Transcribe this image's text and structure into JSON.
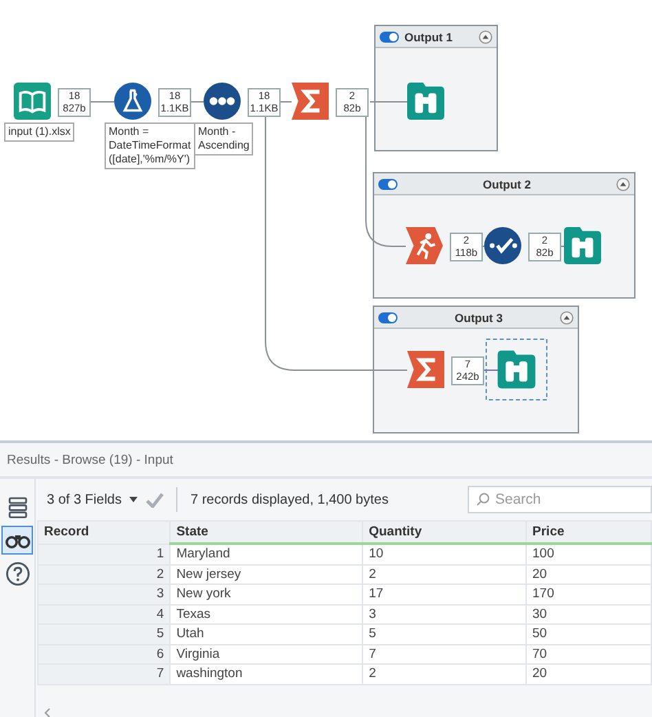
{
  "workflow": {
    "tools": [
      {
        "kind": "input",
        "label": "input (1).xlsx",
        "selected": false,
        "output": {
          "records": "18",
          "size": "827b"
        }
      },
      {
        "kind": "formula",
        "label": "Month =\nDateTimeFormat\n([date],'%m/%Y')",
        "selected": false,
        "output": {
          "records": "18",
          "size": "1.1KB"
        }
      },
      {
        "kind": "sort",
        "label": "Month -\nAscending",
        "selected": false,
        "output": {
          "records": "18",
          "size": "1.1KB"
        }
      },
      {
        "kind": "summarize",
        "selected": false,
        "output": {
          "records": "2",
          "size": "82b"
        }
      }
    ],
    "containers": [
      {
        "title": "Output 1",
        "enabled": true,
        "tools": [
          {
            "kind": "browse",
            "selected": false
          }
        ]
      },
      {
        "title": "Output 2",
        "enabled": true,
        "tools": [
          {
            "kind": "filter",
            "selected": false,
            "output": {
              "records": "2",
              "size": "118b"
            }
          },
          {
            "kind": "select",
            "selected": false,
            "output": {
              "records": "2",
              "size": "82b"
            }
          },
          {
            "kind": "browse",
            "selected": false
          }
        ]
      },
      {
        "title": "Output 3",
        "enabled": true,
        "tools": [
          {
            "kind": "summarize",
            "selected": false,
            "output": {
              "records": "7",
              "size": "242b"
            }
          },
          {
            "kind": "browse",
            "selected": true
          }
        ]
      }
    ]
  },
  "results": {
    "title": "Results - Browse (19) - Input",
    "sidebar": [
      {
        "kind": "layout",
        "selected": false
      },
      {
        "kind": "browse",
        "selected": true
      },
      {
        "kind": "help",
        "selected": false
      }
    ],
    "fields": "3 of 3 Fields",
    "status": "7 records displayed, 1,400 bytes",
    "search": {
      "placeholder": "Search"
    },
    "table": {
      "columns": [
        "Record",
        "State",
        "Quantity",
        "Price"
      ],
      "rows": [
        [
          "1",
          "Maryland",
          "10",
          "100"
        ],
        [
          "2",
          "New jersey",
          "2",
          "20"
        ],
        [
          "3",
          "New york",
          "17",
          "170"
        ],
        [
          "4",
          "Texas",
          "3",
          "30"
        ],
        [
          "5",
          "Utah",
          "5",
          "50"
        ],
        [
          "6",
          "Virginia",
          "7",
          "70"
        ],
        [
          "7",
          "washington",
          "2",
          "20"
        ]
      ]
    }
  }
}
